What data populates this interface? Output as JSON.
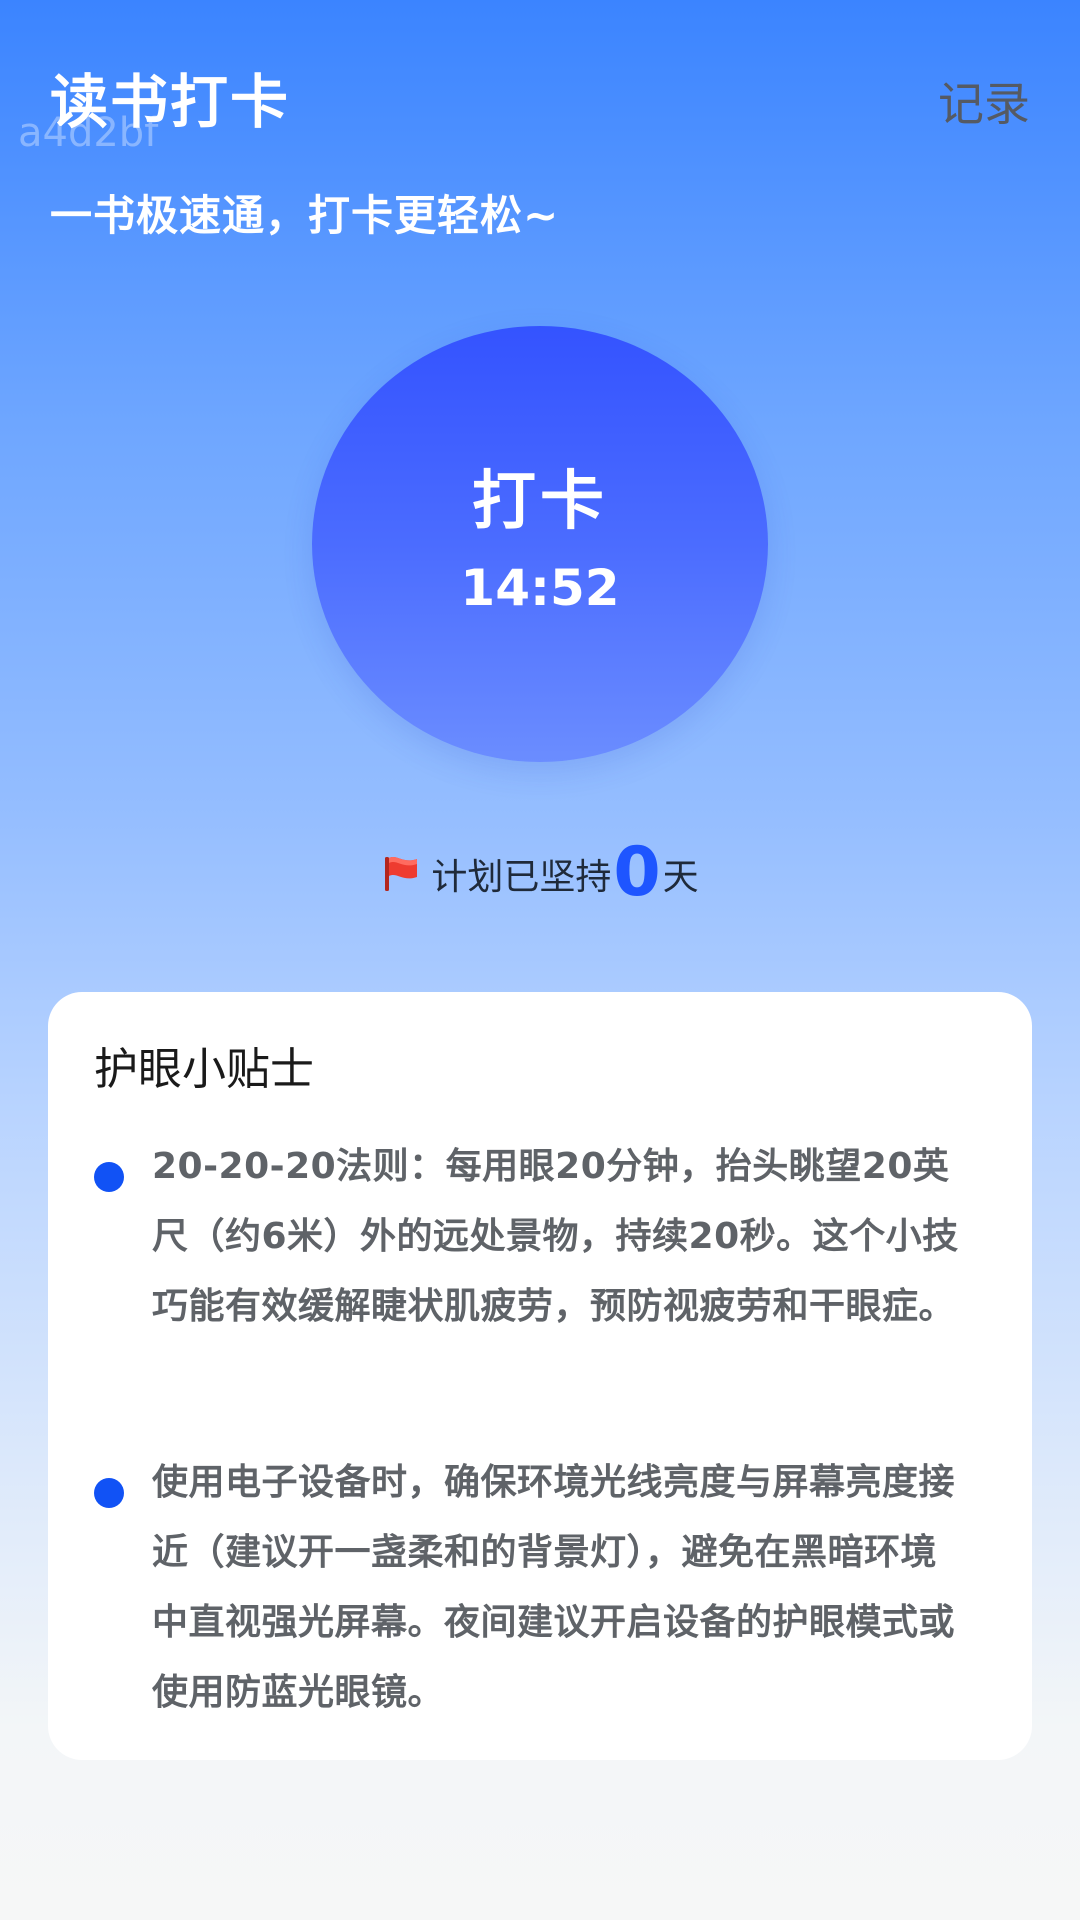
{
  "header": {
    "title": "读书打卡",
    "watermark": "a4d2bf",
    "record_label": "记录"
  },
  "subtitle": "一书极速通，打卡更轻松~",
  "checkin": {
    "label": "打卡",
    "time": "14:52"
  },
  "streak": {
    "prefix": "计划已坚持",
    "count": "0",
    "suffix": "天",
    "icon": "red-flag-icon"
  },
  "tips": {
    "title": "护眼小贴士",
    "items": [
      "20-20-20法则：每用眼20分钟，抬头眺望20英尺（约6米）外的远处景物，持续20秒。这个小技巧能有效缓解睫状肌疲劳，预防视疲劳和干眼症。",
      "使用电子设备时，确保环境光线亮度与屏幕亮度接近（建议开一盏柔和的背景灯），避免在黑暗环境中直视强光屏幕。夜间建议开启设备的护眼模式或使用防蓝光眼镜。"
    ]
  },
  "colors": {
    "accent": "#1e55ff",
    "bullet": "#1152f5",
    "circle_top": "#3453ff",
    "circle_bottom": "#6b8dff"
  }
}
